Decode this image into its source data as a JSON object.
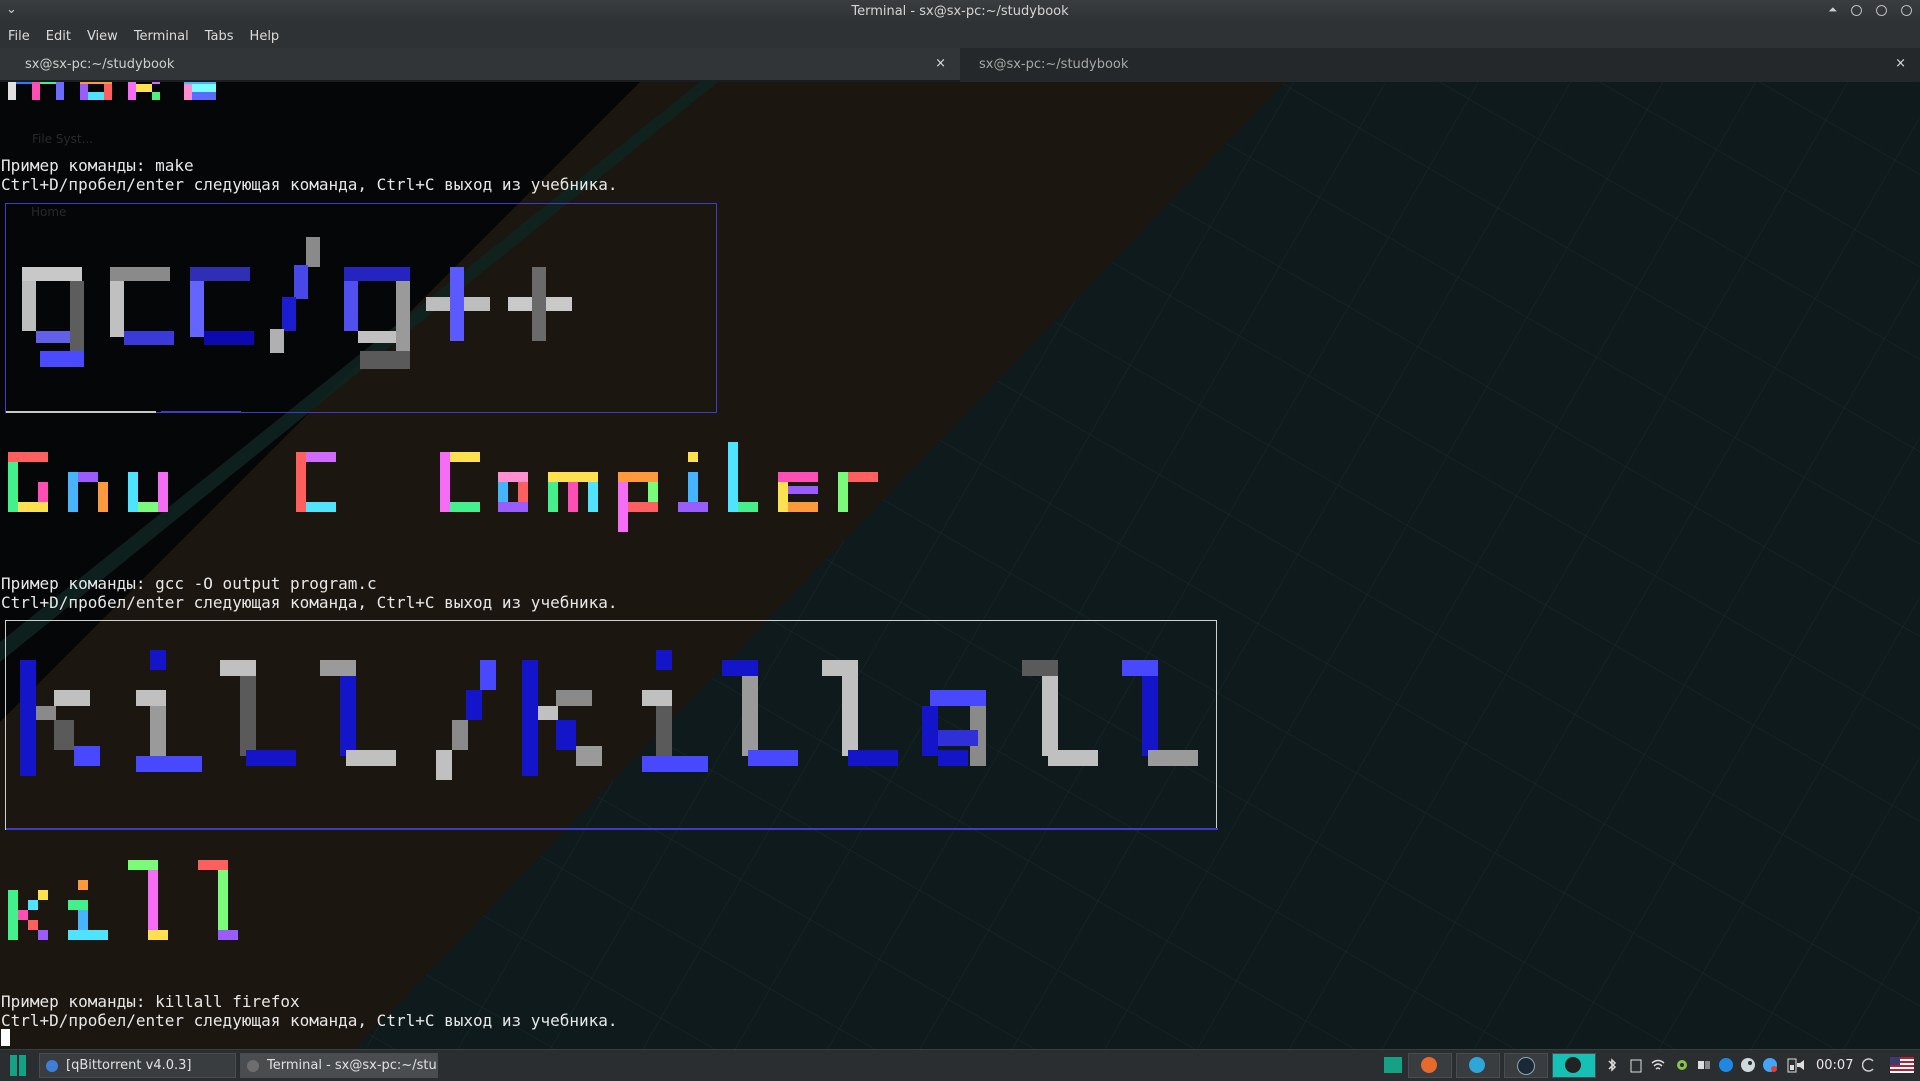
{
  "window": {
    "title": "Terminal - sx@sx-pc:~/studybook",
    "menu_glyph": "⌄"
  },
  "menu": {
    "items": [
      "File",
      "Edit",
      "View",
      "Terminal",
      "Tabs",
      "Help"
    ]
  },
  "tabs": [
    {
      "label": "sx@sx-pc:~/studybook",
      "close": "×",
      "active": true
    },
    {
      "label": "sx@sx-pc:~/studybook",
      "close": "×",
      "active": false
    }
  ],
  "terminal": {
    "lines": [
      "Пример команды: make",
      "Ctrl+D/пробел/enter следующая команда, Ctrl+C выход из учебника.",
      "Пример команды: gcc -O output program.c",
      "Ctrl+D/пробел/enter следующая команда, Ctrl+C выход из учебника.",
      "Пример команды: killall firefox",
      "Ctrl+D/пробел/enter следующая команда, Ctrl+C выход из учебника."
    ],
    "banners": [
      "make",
      "gcc/g++",
      "Gnu C Compiler",
      "kill/killall",
      "Kill"
    ]
  },
  "desktop_ghost": {
    "file_system": "File Syst...",
    "home": "Home"
  },
  "taskbar": {
    "tasks": [
      {
        "label": "[qBittorrent v4.0.3]",
        "icon": "qbittorrent-icon"
      },
      {
        "label": "Terminal - sx@sx-pc:~/stud...",
        "icon": "terminal-icon"
      }
    ],
    "clock": "00:07"
  },
  "colors": {
    "accent": "#16a085",
    "box_border": "#3d3dc8",
    "terminal_text": "#e8e8e8"
  }
}
